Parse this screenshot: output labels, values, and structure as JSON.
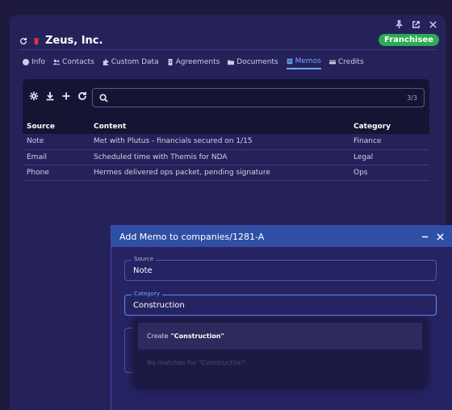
{
  "header": {
    "title": "Zeus, Inc.",
    "badge": "Franchisee"
  },
  "tabs": [
    {
      "label": "Info",
      "icon": "info-icon"
    },
    {
      "label": "Contacts",
      "icon": "contacts-icon"
    },
    {
      "label": "Custom Data",
      "icon": "puzzle-icon"
    },
    {
      "label": "Agreements",
      "icon": "document-icon"
    },
    {
      "label": "Documents",
      "icon": "folder-icon"
    },
    {
      "label": "Memos",
      "icon": "memo-icon",
      "active": true
    },
    {
      "label": "Credits",
      "icon": "card-icon"
    }
  ],
  "grid": {
    "search_count": "3/3",
    "columns": [
      "Source",
      "Content",
      "Category"
    ],
    "rows": [
      [
        "Note",
        "Met with Plutus - financials secured on 1/15",
        "Finance"
      ],
      [
        "Email",
        "Scheduled time with Themis for NDA",
        "Legal"
      ],
      [
        "Phone",
        "Hermes delivered ops packet, pending signature",
        "Ops"
      ]
    ]
  },
  "dialog": {
    "title": "Add Memo to companies/1281-A",
    "source_label": "Source",
    "source_value": "Note",
    "category_label": "Category",
    "category_value": "Construction"
  },
  "menu": {
    "create_prefix": "Create",
    "create_value": "\"Construction\"",
    "no_matches": "No matches for \"Construction\""
  },
  "colors": {
    "accent": "#6fa8ff",
    "badge": "#2bab53",
    "dialog_header": "#2f4fa6"
  }
}
